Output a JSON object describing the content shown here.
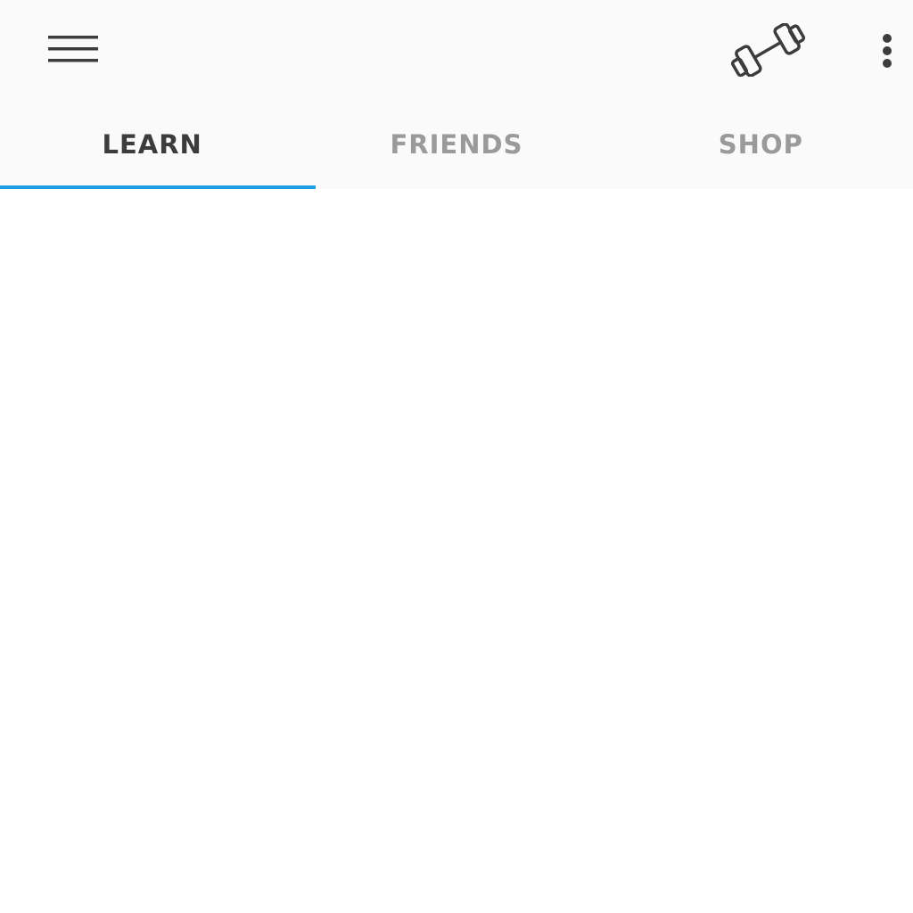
{
  "toolbar": {
    "menu_icon": "hamburger-menu-icon",
    "practice_icon": "dumbbell-icon",
    "overflow_icon": "more-vertical-icon"
  },
  "tabs": [
    {
      "label": "LEARN",
      "active": true
    },
    {
      "label": "FRIENDS",
      "active": false
    },
    {
      "label": "SHOP",
      "active": false
    }
  ],
  "colors": {
    "accent": "#1ca0e3",
    "tab_active": "#3c3c3c",
    "tab_inactive": "#9a9a9a",
    "appbar_bg": "#fafafa",
    "icon": "#3c3c3c"
  }
}
